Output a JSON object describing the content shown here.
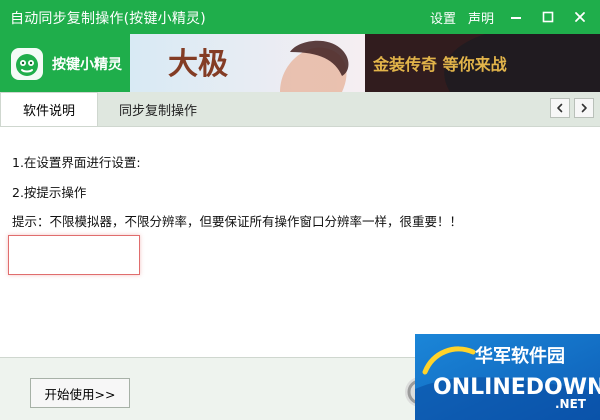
{
  "window": {
    "title": "自动同步复制操作(按键小精灵)",
    "actions": {
      "settings": "设置",
      "statement": "声明"
    }
  },
  "banner": {
    "logo_text": "按键小精灵",
    "ad_left_text": "大极",
    "ad_right_text": "金装传奇 等你来战"
  },
  "tabs": [
    {
      "label": "软件说明"
    },
    {
      "label": "同步复制操作"
    }
  ],
  "content": {
    "lines": [
      "1.在设置界面进行设置:",
      "2.按提示操作",
      "提示：不限模拟器，不限分辨率，但要保证所有操作窗口分辨率一样，很重要！！"
    ]
  },
  "footer": {
    "start_button": "开始使用>>"
  },
  "watermark": {
    "cn": "华军软件园",
    "en": "ONLINEDOWN",
    "suffix": ".NET"
  }
}
